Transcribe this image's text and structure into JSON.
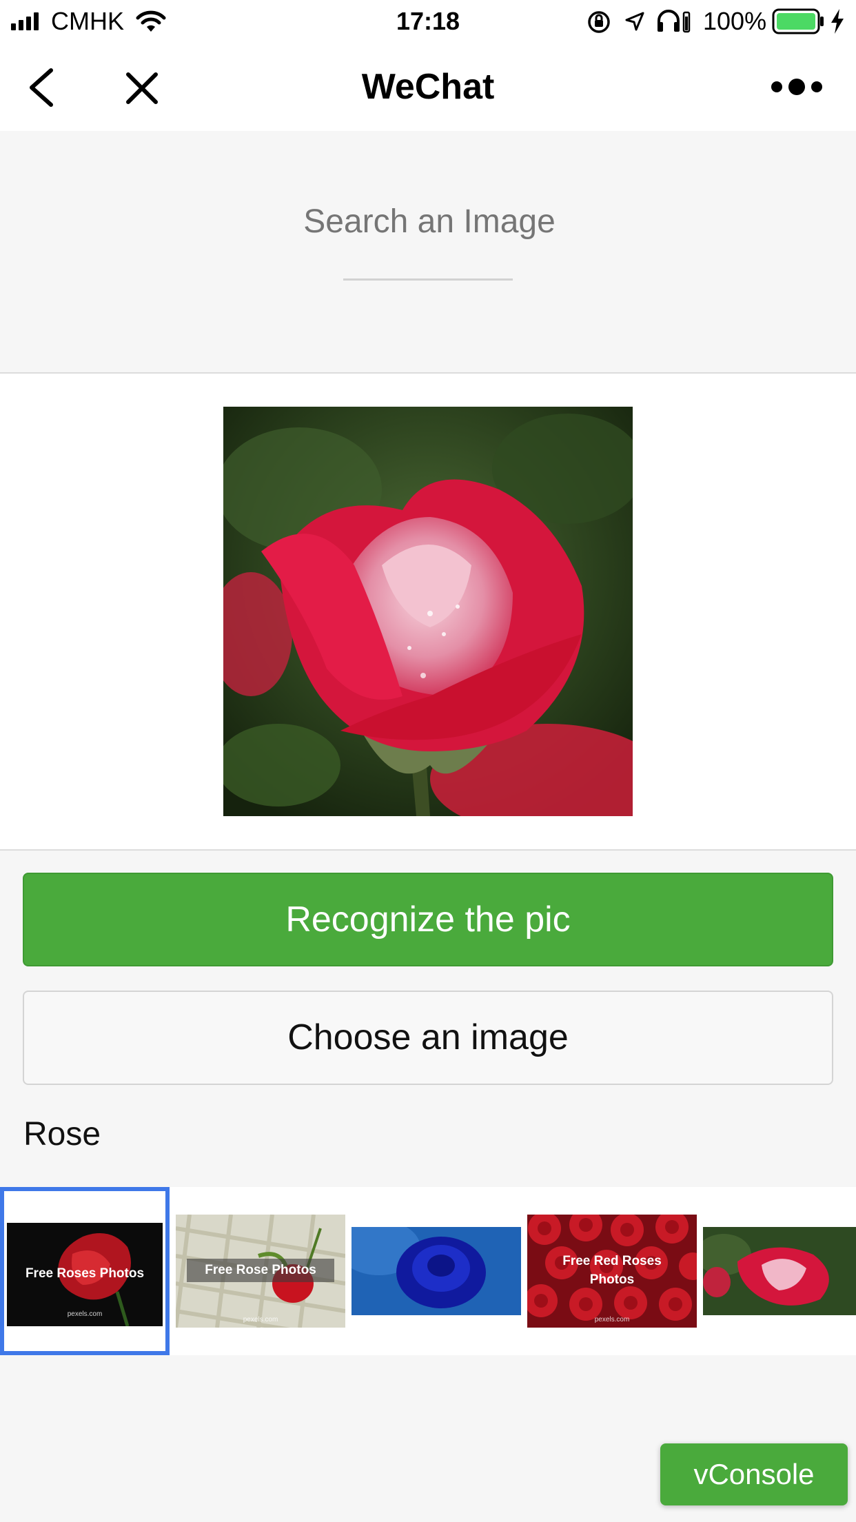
{
  "status_bar": {
    "carrier": "CMHK",
    "time": "17:18",
    "battery": "100%"
  },
  "nav": {
    "title": "WeChat"
  },
  "search": {
    "placeholder": "Search an Image"
  },
  "buttons": {
    "recognize": "Recognize the pic",
    "choose": "Choose an image"
  },
  "result": {
    "label": "Rose"
  },
  "thumbnails": [
    {
      "caption": "Free Roses Photos",
      "watermark": "pexels.com"
    },
    {
      "caption": "Free Rose Photos",
      "watermark": "pexels.com"
    },
    {
      "caption": ""
    },
    {
      "caption_line1": "Free Red Roses",
      "caption_line2": "Photos",
      "watermark": "pexels.com"
    },
    {
      "caption": ""
    }
  ],
  "vconsole": {
    "label": "vConsole"
  },
  "colors": {
    "accent_green": "#4aaa3c",
    "selection_blue": "#3f78e8"
  }
}
